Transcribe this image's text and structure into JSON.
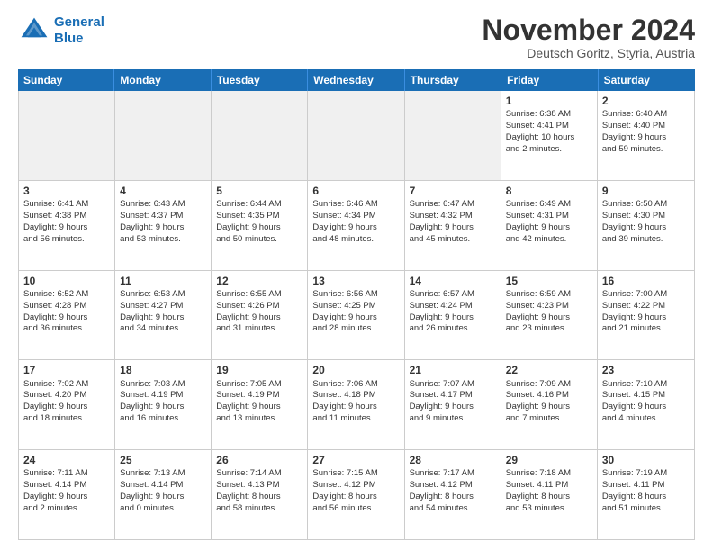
{
  "logo": {
    "line1": "General",
    "line2": "Blue"
  },
  "title": "November 2024",
  "subtitle": "Deutsch Goritz, Styria, Austria",
  "weekdays": [
    "Sunday",
    "Monday",
    "Tuesday",
    "Wednesday",
    "Thursday",
    "Friday",
    "Saturday"
  ],
  "rows": [
    [
      {
        "day": "",
        "info": "",
        "shaded": true
      },
      {
        "day": "",
        "info": "",
        "shaded": true
      },
      {
        "day": "",
        "info": "",
        "shaded": true
      },
      {
        "day": "",
        "info": "",
        "shaded": true
      },
      {
        "day": "",
        "info": "",
        "shaded": true
      },
      {
        "day": "1",
        "info": "Sunrise: 6:38 AM\nSunset: 4:41 PM\nDaylight: 10 hours\nand 2 minutes.",
        "shaded": false
      },
      {
        "day": "2",
        "info": "Sunrise: 6:40 AM\nSunset: 4:40 PM\nDaylight: 9 hours\nand 59 minutes.",
        "shaded": false
      }
    ],
    [
      {
        "day": "3",
        "info": "Sunrise: 6:41 AM\nSunset: 4:38 PM\nDaylight: 9 hours\nand 56 minutes.",
        "shaded": false
      },
      {
        "day": "4",
        "info": "Sunrise: 6:43 AM\nSunset: 4:37 PM\nDaylight: 9 hours\nand 53 minutes.",
        "shaded": false
      },
      {
        "day": "5",
        "info": "Sunrise: 6:44 AM\nSunset: 4:35 PM\nDaylight: 9 hours\nand 50 minutes.",
        "shaded": false
      },
      {
        "day": "6",
        "info": "Sunrise: 6:46 AM\nSunset: 4:34 PM\nDaylight: 9 hours\nand 48 minutes.",
        "shaded": false
      },
      {
        "day": "7",
        "info": "Sunrise: 6:47 AM\nSunset: 4:32 PM\nDaylight: 9 hours\nand 45 minutes.",
        "shaded": false
      },
      {
        "day": "8",
        "info": "Sunrise: 6:49 AM\nSunset: 4:31 PM\nDaylight: 9 hours\nand 42 minutes.",
        "shaded": false
      },
      {
        "day": "9",
        "info": "Sunrise: 6:50 AM\nSunset: 4:30 PM\nDaylight: 9 hours\nand 39 minutes.",
        "shaded": false
      }
    ],
    [
      {
        "day": "10",
        "info": "Sunrise: 6:52 AM\nSunset: 4:28 PM\nDaylight: 9 hours\nand 36 minutes.",
        "shaded": false
      },
      {
        "day": "11",
        "info": "Sunrise: 6:53 AM\nSunset: 4:27 PM\nDaylight: 9 hours\nand 34 minutes.",
        "shaded": false
      },
      {
        "day": "12",
        "info": "Sunrise: 6:55 AM\nSunset: 4:26 PM\nDaylight: 9 hours\nand 31 minutes.",
        "shaded": false
      },
      {
        "day": "13",
        "info": "Sunrise: 6:56 AM\nSunset: 4:25 PM\nDaylight: 9 hours\nand 28 minutes.",
        "shaded": false
      },
      {
        "day": "14",
        "info": "Sunrise: 6:57 AM\nSunset: 4:24 PM\nDaylight: 9 hours\nand 26 minutes.",
        "shaded": false
      },
      {
        "day": "15",
        "info": "Sunrise: 6:59 AM\nSunset: 4:23 PM\nDaylight: 9 hours\nand 23 minutes.",
        "shaded": false
      },
      {
        "day": "16",
        "info": "Sunrise: 7:00 AM\nSunset: 4:22 PM\nDaylight: 9 hours\nand 21 minutes.",
        "shaded": false
      }
    ],
    [
      {
        "day": "17",
        "info": "Sunrise: 7:02 AM\nSunset: 4:20 PM\nDaylight: 9 hours\nand 18 minutes.",
        "shaded": false
      },
      {
        "day": "18",
        "info": "Sunrise: 7:03 AM\nSunset: 4:19 PM\nDaylight: 9 hours\nand 16 minutes.",
        "shaded": false
      },
      {
        "day": "19",
        "info": "Sunrise: 7:05 AM\nSunset: 4:19 PM\nDaylight: 9 hours\nand 13 minutes.",
        "shaded": false
      },
      {
        "day": "20",
        "info": "Sunrise: 7:06 AM\nSunset: 4:18 PM\nDaylight: 9 hours\nand 11 minutes.",
        "shaded": false
      },
      {
        "day": "21",
        "info": "Sunrise: 7:07 AM\nSunset: 4:17 PM\nDaylight: 9 hours\nand 9 minutes.",
        "shaded": false
      },
      {
        "day": "22",
        "info": "Sunrise: 7:09 AM\nSunset: 4:16 PM\nDaylight: 9 hours\nand 7 minutes.",
        "shaded": false
      },
      {
        "day": "23",
        "info": "Sunrise: 7:10 AM\nSunset: 4:15 PM\nDaylight: 9 hours\nand 4 minutes.",
        "shaded": false
      }
    ],
    [
      {
        "day": "24",
        "info": "Sunrise: 7:11 AM\nSunset: 4:14 PM\nDaylight: 9 hours\nand 2 minutes.",
        "shaded": false
      },
      {
        "day": "25",
        "info": "Sunrise: 7:13 AM\nSunset: 4:14 PM\nDaylight: 9 hours\nand 0 minutes.",
        "shaded": false
      },
      {
        "day": "26",
        "info": "Sunrise: 7:14 AM\nSunset: 4:13 PM\nDaylight: 8 hours\nand 58 minutes.",
        "shaded": false
      },
      {
        "day": "27",
        "info": "Sunrise: 7:15 AM\nSunset: 4:12 PM\nDaylight: 8 hours\nand 56 minutes.",
        "shaded": false
      },
      {
        "day": "28",
        "info": "Sunrise: 7:17 AM\nSunset: 4:12 PM\nDaylight: 8 hours\nand 54 minutes.",
        "shaded": false
      },
      {
        "day": "29",
        "info": "Sunrise: 7:18 AM\nSunset: 4:11 PM\nDaylight: 8 hours\nand 53 minutes.",
        "shaded": false
      },
      {
        "day": "30",
        "info": "Sunrise: 7:19 AM\nSunset: 4:11 PM\nDaylight: 8 hours\nand 51 minutes.",
        "shaded": false
      }
    ]
  ]
}
